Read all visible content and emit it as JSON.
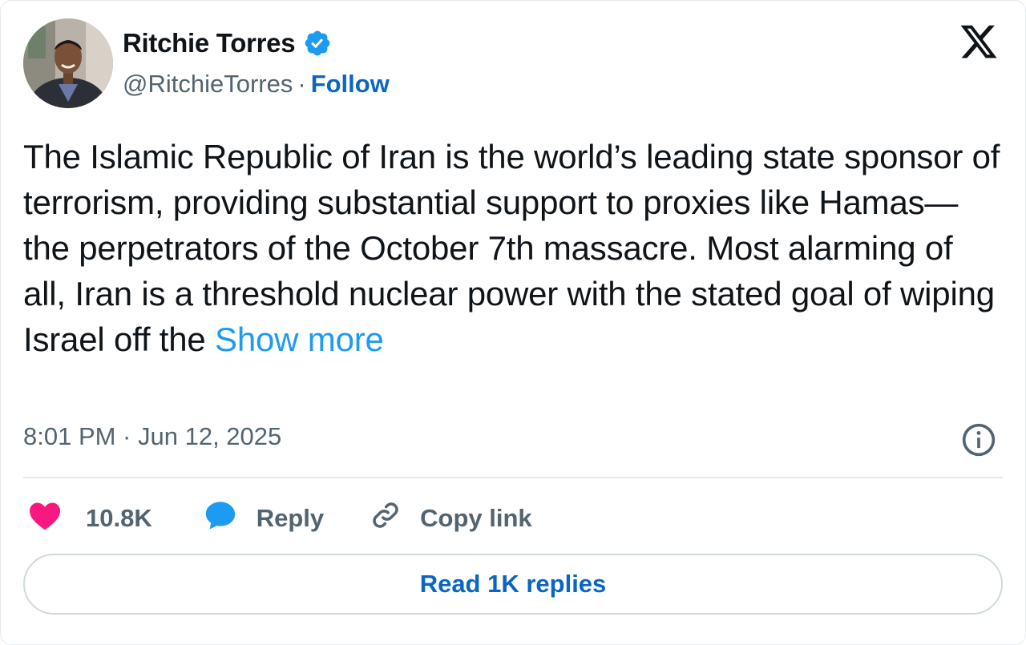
{
  "author": {
    "name": "Ritchie Torres",
    "handle": "@RitchieTorres",
    "separator": "·",
    "follow_label": "Follow",
    "verified": true
  },
  "tweet": {
    "text": "The Islamic Republic of Iran is the world’s leading state sponsor of terrorism, providing substantial support to proxies like Hamas—the perpetrators of the October 7th massacre. Most alarming of all, Iran is a threshold nuclear power with the stated goal of wiping Israel off the ",
    "show_more_label": "Show more",
    "timestamp": "8:01 PM · Jun 12, 2025"
  },
  "actions": {
    "like_count": "10.8K",
    "reply_label": "Reply",
    "copy_link_label": "Copy link"
  },
  "footer": {
    "read_replies_label": "Read 1K replies"
  },
  "icons": {
    "logo": "x-logo-icon",
    "verified": "verified-badge-icon",
    "info": "info-icon",
    "like": "heart-icon",
    "reply": "speech-bubble-icon",
    "copy": "link-icon"
  },
  "colors": {
    "link_blue": "#1d9bf0",
    "follow_blue": "#0a66c2",
    "heart_pink": "#f91880",
    "secondary_gray": "#536471",
    "text_dark": "#0f1419"
  }
}
